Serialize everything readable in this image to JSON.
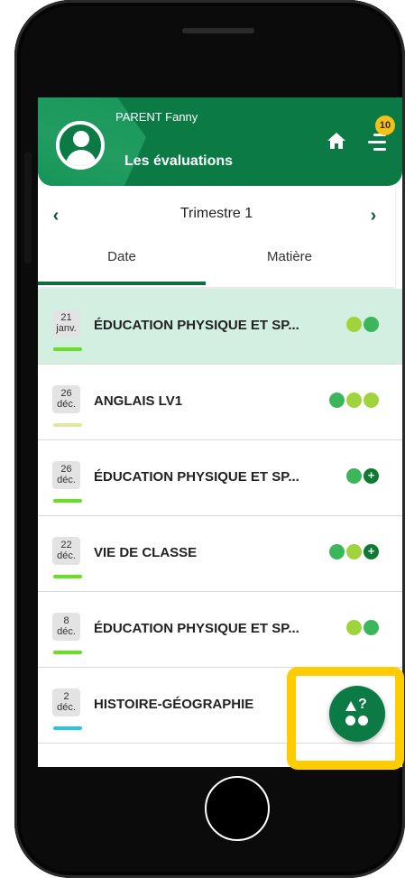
{
  "header": {
    "user_name": "PARENT Fanny",
    "page_title": "Les évaluations",
    "notification_count": "10",
    "brand_color": "#0b7a45",
    "badge_color": "#f2c21b"
  },
  "period": {
    "title": "Trimestre 1",
    "tabs": [
      {
        "label": "Date",
        "selected": true
      },
      {
        "label": "Matière",
        "selected": false
      }
    ]
  },
  "evaluations": [
    {
      "day": "21",
      "month": "janv.",
      "subject": "ÉDUCATION PHYSIQUE ET SP...",
      "subject_color": "#66e022",
      "active": true,
      "grades": [
        {
          "color": "#9fd43c"
        },
        {
          "color": "#3cb65a"
        }
      ]
    },
    {
      "day": "26",
      "month": "déc.",
      "subject": "ANGLAIS LV1",
      "subject_color": "#e0e8a0",
      "active": false,
      "grades": [
        {
          "color": "#3cb65a"
        },
        {
          "color": "#9fd43c"
        },
        {
          "color": "#9fd43c"
        }
      ]
    },
    {
      "day": "26",
      "month": "déc.",
      "subject": "ÉDUCATION PHYSIQUE ET SP...",
      "subject_color": "#66e022",
      "active": false,
      "grades": [
        {
          "color": "#3cb65a"
        },
        {
          "color": "#0e7a32",
          "plus": true
        }
      ]
    },
    {
      "day": "22",
      "month": "déc.",
      "subject": "VIE DE CLASSE",
      "subject_color": "#66e022",
      "active": false,
      "grades": [
        {
          "color": "#3cb65a"
        },
        {
          "color": "#9fd43c"
        },
        {
          "color": "#0e7a32",
          "plus": true
        }
      ]
    },
    {
      "day": "8",
      "month": "déc.",
      "subject": "ÉDUCATION PHYSIQUE ET SP...",
      "subject_color": "#66e022",
      "active": false,
      "grades": [
        {
          "color": "#9fd43c"
        },
        {
          "color": "#3cb65a"
        }
      ]
    },
    {
      "day": "2",
      "month": "déc.",
      "subject": "HISTOIRE-GÉOGRAPHIE",
      "subject_color": "#2bc4e6",
      "active": false,
      "grades": [
        {
          "color": "#9fd43c"
        }
      ]
    }
  ],
  "fab": {
    "icon": "shapes-question-icon",
    "highlight_color": "#ffcc00"
  }
}
